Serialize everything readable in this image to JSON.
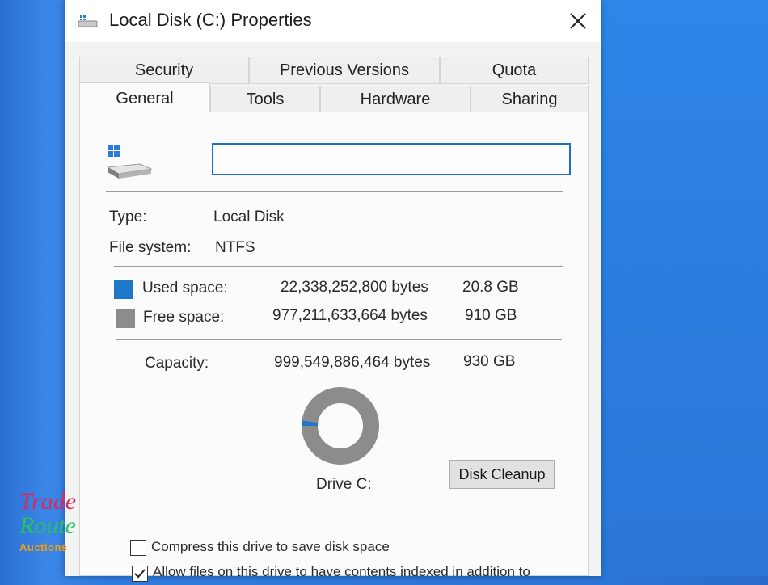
{
  "window": {
    "title": "Local Disk (C:) Properties",
    "title_icon": "drive-icon",
    "close_icon": "close-icon"
  },
  "tabs": {
    "row_back": [
      "Security",
      "Previous Versions",
      "Quota"
    ],
    "row_front": [
      "General",
      "Tools",
      "Hardware",
      "Sharing"
    ],
    "active": "General"
  },
  "general": {
    "drive_label_value": "",
    "type_label": "Type:",
    "type_value": "Local Disk",
    "fs_label": "File system:",
    "fs_value": "NTFS",
    "used_label": "Used space:",
    "used_bytes": "22,338,252,800 bytes",
    "used_gb": "20.8 GB",
    "used_color": "#1f77c8",
    "free_label": "Free space:",
    "free_bytes": "977,211,633,664 bytes",
    "free_gb": "910 GB",
    "free_color": "#8c8c8c",
    "capacity_label": "Capacity:",
    "capacity_bytes": "999,549,886,464 bytes",
    "capacity_gb": "930 GB",
    "used_fraction": 0.022,
    "drive_caption": "Drive C:",
    "cleanup_button": "Disk Cleanup",
    "compress_label": "Compress this drive to save disk space",
    "compress_checked": false,
    "index_label": "Allow files on this drive to have contents indexed in addition to",
    "index_checked": true
  },
  "watermark": {
    "line1": "Trade",
    "line2": "Route",
    "line3": "Auctions"
  }
}
